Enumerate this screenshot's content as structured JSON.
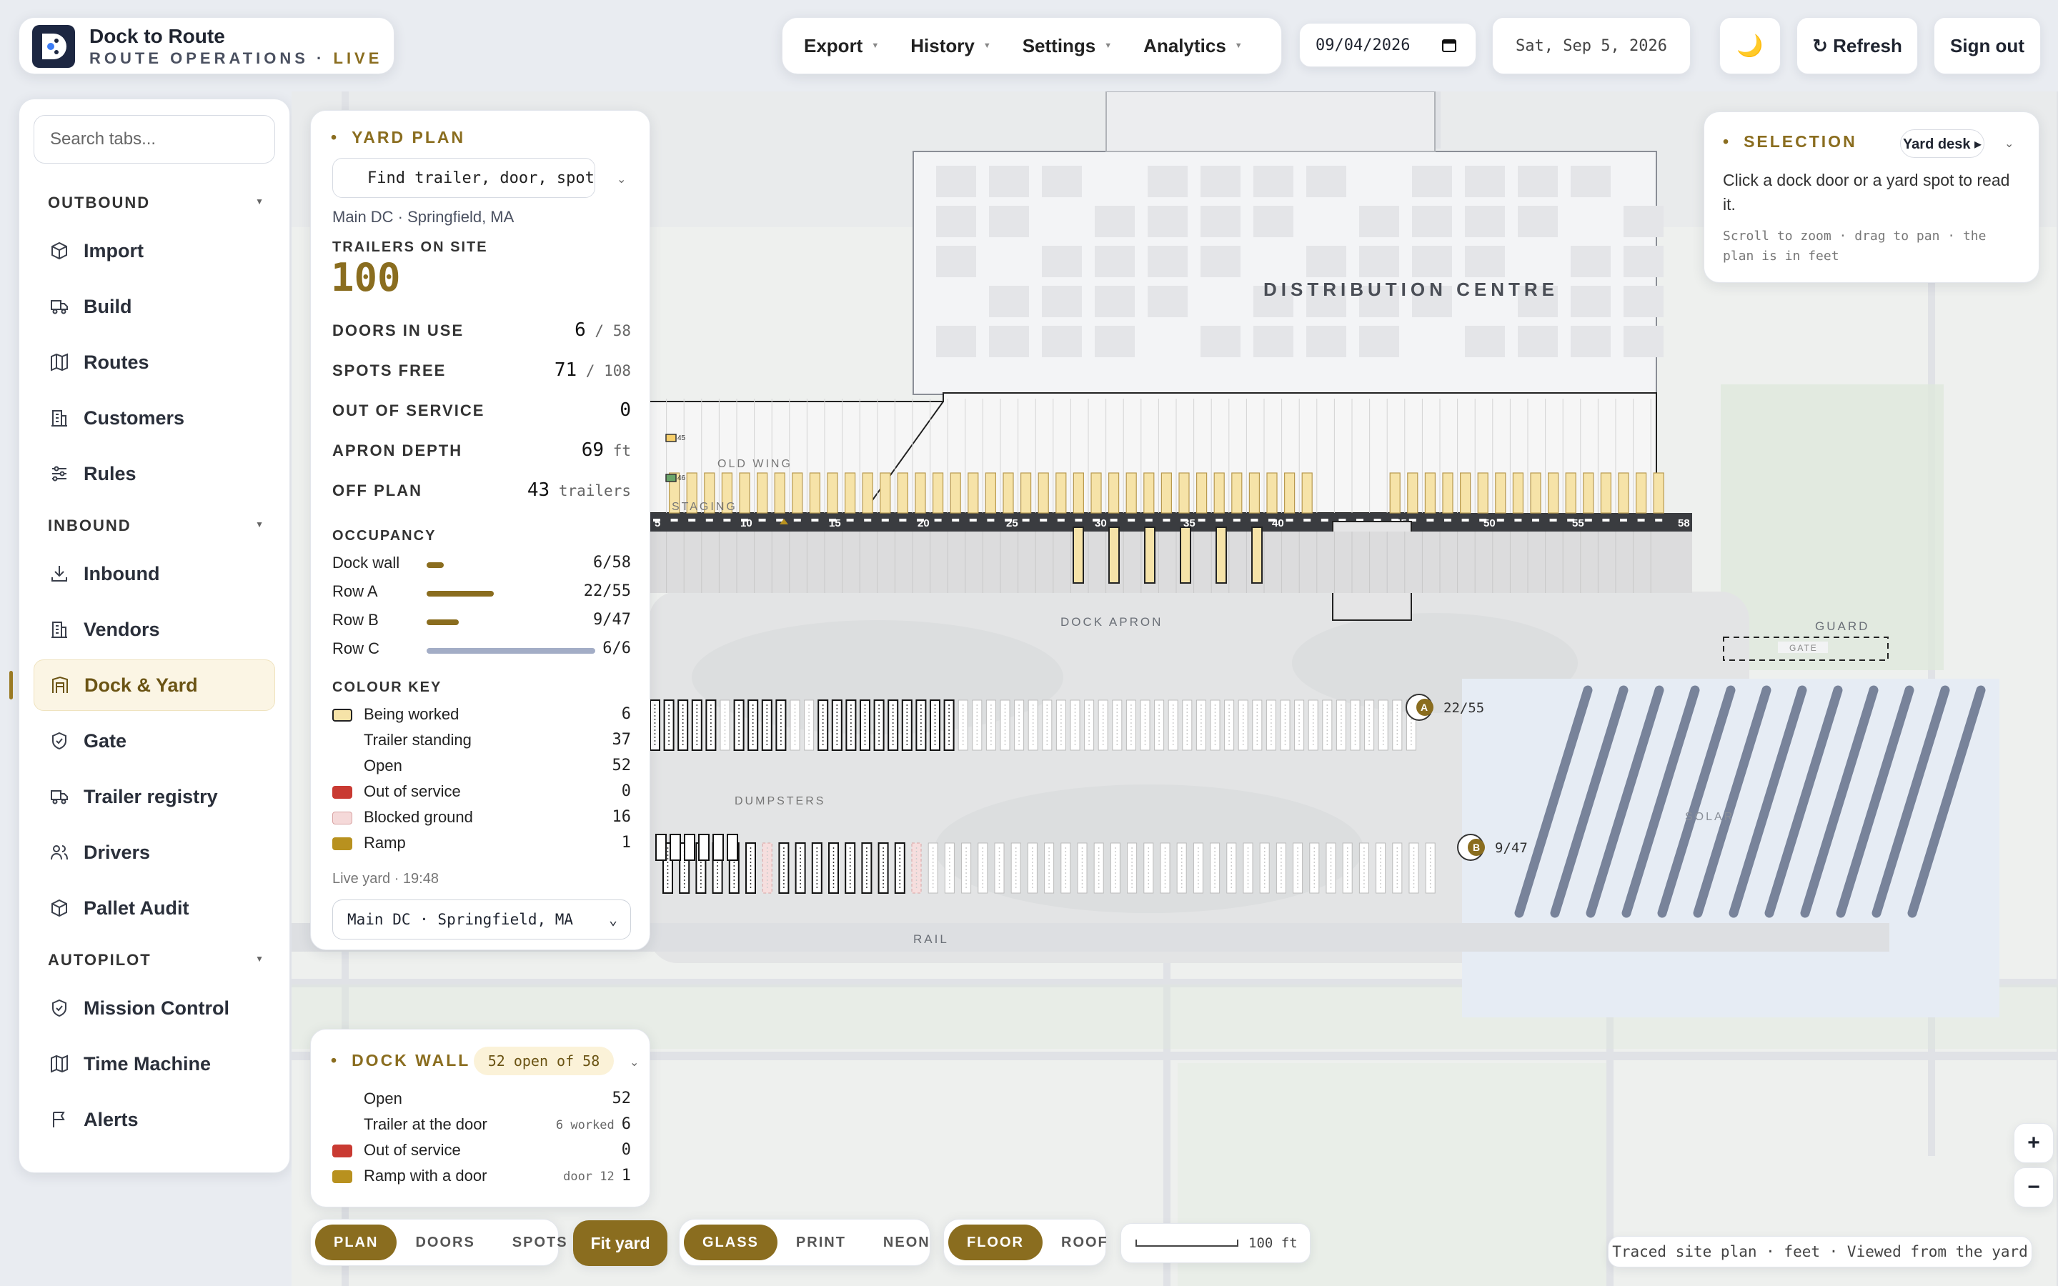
{
  "brand": {
    "name": "Dock to Route",
    "subtitle": "ROUTE OPERATIONS · ",
    "live": "LIVE"
  },
  "menus": [
    {
      "label": "Export"
    },
    {
      "label": "History"
    },
    {
      "label": "Settings"
    },
    {
      "label": "Analytics"
    }
  ],
  "date_input": "09/04/2026",
  "date_display": "Sat, Sep 5, 2026",
  "theme_icon": "moon-icon",
  "refresh_label": "↻ Refresh",
  "signout_label": "Sign out",
  "sidebar": {
    "search_placeholder": "Search tabs...",
    "sections": [
      {
        "title": "OUTBOUND",
        "items": [
          {
            "label": "Import",
            "icon": "box-icon"
          },
          {
            "label": "Build",
            "icon": "truck-icon"
          },
          {
            "label": "Routes",
            "icon": "map-icon"
          },
          {
            "label": "Customers",
            "icon": "building-icon"
          },
          {
            "label": "Rules",
            "icon": "sliders-icon"
          }
        ]
      },
      {
        "title": "INBOUND",
        "items": [
          {
            "label": "Inbound",
            "icon": "download-icon"
          },
          {
            "label": "Vendors",
            "icon": "building-icon"
          },
          {
            "label": "Dock & Yard",
            "icon": "dock-icon",
            "active": true
          },
          {
            "label": "Gate",
            "icon": "shield-icon"
          },
          {
            "label": "Trailer registry",
            "icon": "truck-icon"
          },
          {
            "label": "Drivers",
            "icon": "users-icon"
          },
          {
            "label": "Pallet Audit",
            "icon": "box-icon"
          }
        ]
      },
      {
        "title": "AUTOPILOT",
        "items": [
          {
            "label": "Mission Control",
            "icon": "shield-icon"
          },
          {
            "label": "Time Machine",
            "icon": "map-icon"
          },
          {
            "label": "Alerts",
            "icon": "flag-icon"
          }
        ]
      }
    ]
  },
  "yard_plan": {
    "title": "YARD PLAN",
    "find_placeholder": "Find trailer, door, spot",
    "site": "Main DC · Springfield, MA",
    "trailers_label": "TRAILERS ON SITE",
    "trailers_value": "100",
    "stats": [
      {
        "label": "DOORS IN USE",
        "value": "6",
        "suffix": " / 58"
      },
      {
        "label": "SPOTS FREE",
        "value": "71",
        "suffix": " / 108"
      },
      {
        "label": "OUT OF SERVICE",
        "value": "0",
        "suffix": ""
      },
      {
        "label": "APRON DEPTH",
        "value": "69",
        "suffix": " ft"
      },
      {
        "label": "OFF PLAN",
        "value": "43",
        "suffix": " trailers"
      }
    ],
    "occupancy_title": "OCCUPANCY",
    "occupancy": [
      {
        "label": "Dock wall",
        "count": "6/58",
        "fraction": 0.103,
        "color": "#8a6d1f"
      },
      {
        "label": "Row A",
        "count": "22/55",
        "fraction": 0.4,
        "color": "#8a6d1f"
      },
      {
        "label": "Row B",
        "count": "9/47",
        "fraction": 0.191,
        "color": "#8a6d1f"
      },
      {
        "label": "Row C",
        "count": "6/6",
        "fraction": 1.0,
        "color": "#a3adc6"
      }
    ],
    "key_title": "COLOUR KEY",
    "key": [
      {
        "label": "Being worked",
        "count": "6",
        "swatch": "worked"
      },
      {
        "label": "Trailer standing",
        "count": "37",
        "swatch": "none"
      },
      {
        "label": "Open",
        "count": "52",
        "swatch": "none"
      },
      {
        "label": "Out of service",
        "count": "0",
        "swatch": "oos"
      },
      {
        "label": "Blocked ground",
        "count": "16",
        "swatch": "blocked"
      },
      {
        "label": "Ramp",
        "count": "1",
        "swatch": "ramp"
      }
    ],
    "live_time": "Live yard · 19:48",
    "site_select": "Main DC · Springfield, MA"
  },
  "selection": {
    "title": "SELECTION",
    "desk": "Yard desk ▸",
    "body": "Click a dock door or a yard spot to read it.",
    "hint": "Scroll to zoom · drag to pan · the plan is in feet"
  },
  "dock_wall": {
    "title": "DOCK WALL",
    "badge": "52 open of 58",
    "rows": [
      {
        "label": "Open",
        "note": "",
        "count": "52",
        "swatch": "none"
      },
      {
        "label": "Trailer at the door",
        "note": "6 worked",
        "count": "6",
        "swatch": "none"
      },
      {
        "label": "Out of service",
        "note": "",
        "count": "0",
        "swatch": "oos"
      },
      {
        "label": "Ramp with a door",
        "note": "door 12",
        "count": "1",
        "swatch": "ramp"
      }
    ]
  },
  "map": {
    "building_label": "DISTRIBUTION CENTRE",
    "old_wing": "OLD WING",
    "staging": "STAGING",
    "dock_apron": "DOCK APRON",
    "dumpsters": "DUMPSTERS",
    "rail": "RAIL",
    "guard": "GUARD",
    "gate": "GATE",
    "solar": "SOLAR",
    "door_numbers": [
      "5",
      "10",
      "15",
      "20",
      "25",
      "30",
      "35",
      "40",
      "45",
      "50",
      "55",
      "58"
    ],
    "row_a_label": "A",
    "row_a_count": "22/55",
    "row_b_label": "B",
    "row_b_count": "9/47",
    "staging_tags": [
      "45",
      "46"
    ]
  },
  "toolbar": {
    "view": [
      "PLAN",
      "DOORS",
      "SPOTS"
    ],
    "fit": "Fit yard",
    "style": [
      "GLASS",
      "PRINT",
      "NEON"
    ],
    "level": [
      "FLOOR",
      "ROOF"
    ],
    "scale": "100 ft",
    "credit": "Traced site plan · feet · Viewed from the yard"
  },
  "zoom": {
    "in": "+",
    "out": "−"
  },
  "colors": {
    "accent": "#8a6d1f",
    "worked": "#f6e3a8",
    "oos": "#c93a32",
    "blocked": "#f5d9d9",
    "ramp": "#b8911f"
  }
}
